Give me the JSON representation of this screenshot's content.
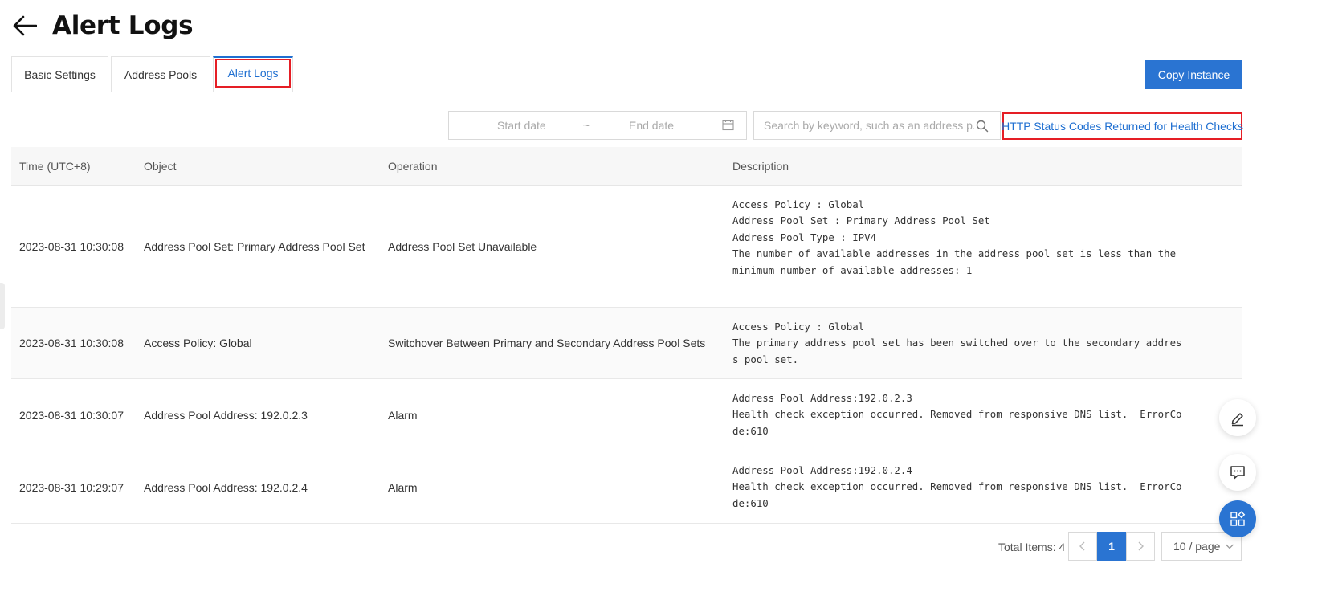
{
  "header": {
    "title": "Alert Logs"
  },
  "tabs": [
    {
      "label": "Basic Settings"
    },
    {
      "label": "Address Pools"
    },
    {
      "label": "Alert Logs"
    }
  ],
  "toolbar": {
    "copy_label": "Copy Instance",
    "date_start_placeholder": "Start date",
    "date_separator": "~",
    "date_end_placeholder": "End date",
    "search_placeholder": "Search by keyword, such as an address p...",
    "http_link": "HTTP Status Codes Returned for Health Checks"
  },
  "table": {
    "columns": [
      "Time (UTC+8)",
      "Object",
      "Operation",
      "Description"
    ],
    "rows": [
      {
        "time": "2023-08-31 10:30:08",
        "object": "Address Pool Set: Primary Address Pool Set",
        "operation": "Address Pool Set Unavailable",
        "description": "Access Policy : Global\nAddress Pool Set : Primary Address Pool Set\nAddress Pool Type : IPV4\nThe number of available addresses in the address pool set is less than the\nminimum number of available addresses: 1"
      },
      {
        "time": "2023-08-31 10:30:08",
        "object": "Access Policy: Global",
        "operation": "Switchover Between Primary and Secondary Address Pool Sets",
        "description": "Access Policy : Global\nThe primary address pool set has been switched over to the secondary addres\ns pool set."
      },
      {
        "time": "2023-08-31 10:30:07",
        "object": "Address Pool Address: 192.0.2.3",
        "operation": "Alarm",
        "description": "Address Pool Address:192.0.2.3\nHealth check exception occurred. Removed from responsive DNS list.  ErrorCo\nde:610"
      },
      {
        "time": "2023-08-31 10:29:07",
        "object": "Address Pool Address: 192.0.2.4",
        "operation": "Alarm",
        "description": "Address Pool Address:192.0.2.4\nHealth check exception occurred. Removed from responsive DNS list.  ErrorCo\nde:610"
      }
    ]
  },
  "pagination": {
    "total_label": "Total Items: 4",
    "current_page": "1",
    "page_size": "10 / page"
  },
  "icons": {
    "back": "arrow-left-icon",
    "calendar": "calendar-icon",
    "search": "search-icon",
    "float": [
      "edit-icon",
      "feedback-chat-icon",
      "apps-grid-icon"
    ]
  },
  "colors": {
    "accent": "#2a74d2",
    "highlight_box": "#e51e25",
    "link": "#1f6fd1"
  }
}
